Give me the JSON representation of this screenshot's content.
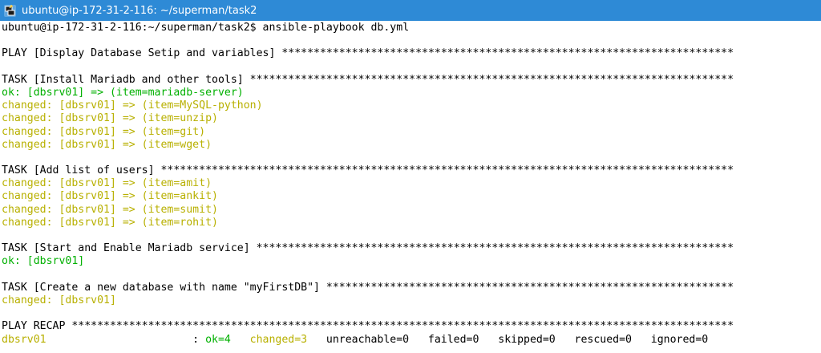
{
  "window": {
    "title": "ubuntu@ip-172-31-2-116: ~/superman/task2"
  },
  "terminal": {
    "lines": [
      {
        "text": "ubuntu@ip-172-31-2-116:~/superman/task2$ ansible-playbook db.yml",
        "style": "plain"
      },
      {
        "text": "",
        "style": "plain"
      },
      {
        "text": "PLAY [Display Database Setip and variables] ***********************************************************************",
        "style": "plain"
      },
      {
        "text": "",
        "style": "plain"
      },
      {
        "text": "TASK [Install Mariadb and other tools] ****************************************************************************",
        "style": "plain"
      },
      {
        "text": "ok: [dbsrv01] => (item=mariadb-server)",
        "style": "ok"
      },
      {
        "text": "changed: [dbsrv01] => (item=MySQL-python)",
        "style": "changed"
      },
      {
        "text": "changed: [dbsrv01] => (item=unzip)",
        "style": "changed"
      },
      {
        "text": "changed: [dbsrv01] => (item=git)",
        "style": "changed"
      },
      {
        "text": "changed: [dbsrv01] => (item=wget)",
        "style": "changed"
      },
      {
        "text": "",
        "style": "plain"
      },
      {
        "text": "TASK [Add list of users] ******************************************************************************************",
        "style": "plain"
      },
      {
        "text": "changed: [dbsrv01] => (item=amit)",
        "style": "changed"
      },
      {
        "text": "changed: [dbsrv01] => (item=ankit)",
        "style": "changed"
      },
      {
        "text": "changed: [dbsrv01] => (item=sumit)",
        "style": "changed"
      },
      {
        "text": "changed: [dbsrv01] => (item=rohit)",
        "style": "changed"
      },
      {
        "text": "",
        "style": "plain"
      },
      {
        "text": "TASK [Start and Enable Mariadb service] ***************************************************************************",
        "style": "plain"
      },
      {
        "text": "ok: [dbsrv01]",
        "style": "ok"
      },
      {
        "text": "",
        "style": "plain"
      },
      {
        "text": "TASK [Create a new database with name \"myFirstDB\"] ****************************************************************",
        "style": "plain"
      },
      {
        "text": "changed: [dbsrv01]",
        "style": "changed"
      },
      {
        "text": "",
        "style": "plain"
      },
      {
        "text": "PLAY RECAP ********************************************************************************************************",
        "style": "plain"
      }
    ],
    "recap": {
      "host": "dbsrv01",
      "separator": ": ",
      "ok": "ok=4",
      "changed": "changed=3",
      "unreachable": "unreachable=0",
      "failed": "failed=0",
      "skipped": "skipped=0",
      "rescued": "rescued=0",
      "ignored": "ignored=0"
    }
  },
  "colors": {
    "titlebar": "#2e8ad6",
    "ok": "#00b000",
    "changed": "#b8b000"
  },
  "icons": {
    "app": "putty-terminal-icon"
  }
}
